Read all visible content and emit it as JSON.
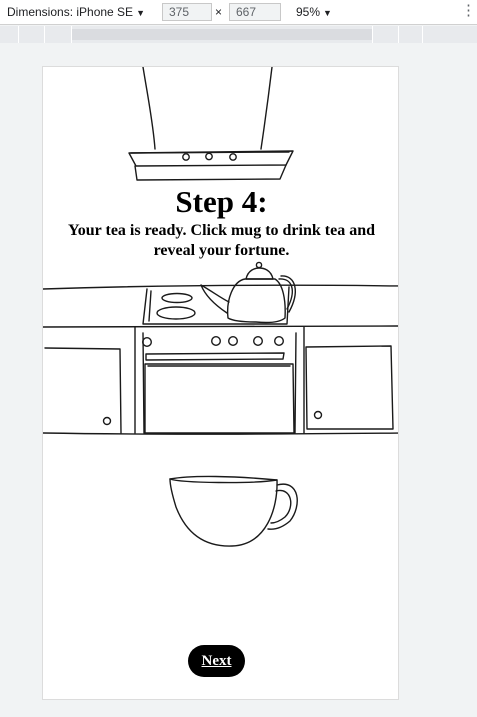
{
  "devtools": {
    "device_label": "Dimensions: iPhone SE",
    "width_value": "375",
    "height_value": "667",
    "times_sign": "×",
    "zoom_label": "95%",
    "caret_icon": "caret-down-icon",
    "more_icon": "vertical-dots-icon"
  },
  "page": {
    "step_title": "Step 4:",
    "step_description": "Your tea is ready. Click mug to drink tea and reveal your fortune.",
    "next_label": "Next"
  },
  "illustrations": {
    "hood": "range-hood-icon",
    "kitchen": "kitchen-counter-icon",
    "kettle": "kettle-icon",
    "mug": "mug-icon"
  }
}
